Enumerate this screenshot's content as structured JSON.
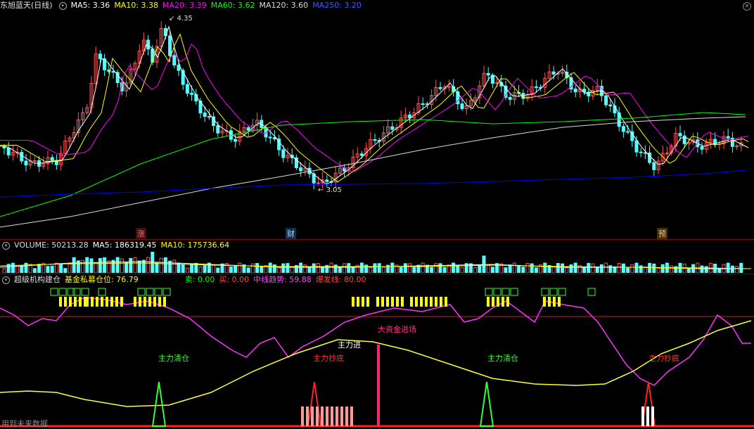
{
  "colors": {
    "ma5": "#ffffff",
    "ma10": "#ffff00",
    "ma20": "#ff00ff",
    "ma60": "#00ff00",
    "ma120": "#dcdcdc",
    "ma250": "#0000ff",
    "up": "#ff5555",
    "down": "#54ffff"
  },
  "price_panel": {
    "title": "东旭蓝天(日线)",
    "ma5": "MA5: 3.36",
    "ma10": "MA10: 3.38",
    "ma20": "MA20: 3.39",
    "ma60": "MA60: 3.62",
    "ma120": "MA120: 3.60",
    "ma250": "MA250: 3.20",
    "high_label": "4.35",
    "low_label": "3.05",
    "markers": [
      "涨",
      "财",
      "预"
    ]
  },
  "volume_panel": {
    "title": "VOLUME: 50213.28",
    "ma5": "MA5: 186319.45",
    "ma10": "MA10: 175736.64"
  },
  "indicator_panel": {
    "title": "超级机构建仓",
    "fund": "基金私募仓位: 76.79",
    "sell": "卖: 0.00",
    "buy": "买: 0.00",
    "trend": "中线趋势: 59.88",
    "burst": "爆发线: 80.00",
    "labels": {
      "clear1": "主力清仓",
      "bottom1": "主力抄底",
      "enter": "主力进",
      "bigfund": "大资金进场",
      "clear2": "主力清仓",
      "bottom2": "主力抄底"
    },
    "footer": "用到未来数据"
  }
}
